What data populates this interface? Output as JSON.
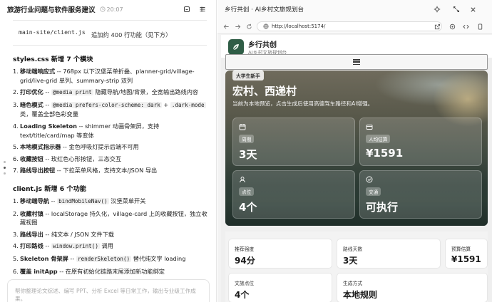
{
  "chat": {
    "title": "旅游行业问题与软件服务建议",
    "time": "20:07",
    "table_row": {
      "file": "main-site/client.js",
      "desc": "追加约 400 行功能（见下方）"
    },
    "styles_heading": "styles.css 新增 7 个模块",
    "styles_items": [
      {
        "num": "1.",
        "label": "移动端响应式",
        "text": " -- 768px 以下汉堡菜单折叠、planner-grid/village-grid/live-grid 单列、summary-strip 双列"
      },
      {
        "num": "2.",
        "label": "打印优化",
        "text": " -- ",
        "code": "@media print",
        "text2": " 隐藏导航/地图/背景，全宽输出路线内容"
      },
      {
        "num": "3.",
        "label": "暗色模式",
        "text": " -- ",
        "code": "@media prefers-color-scheme: dark",
        "text2": " + ",
        "code2": ".dark-mode",
        "text3": " 类，覆盖全部色彩变量"
      },
      {
        "num": "4.",
        "label": "Loading Skeleton",
        "text": " -- shimmer 动画骨架屏，支持 text/title/card/map 等变体"
      },
      {
        "num": "5.",
        "label": "本地模式指示器",
        "text": " -- 金色呼吸灯提示后端不可用"
      },
      {
        "num": "6.",
        "label": "收藏按钮",
        "text": " -- 玫红色心形按钮，三态交互"
      },
      {
        "num": "7.",
        "label": "路线导出按钮",
        "text": " -- 下拉菜单风格，支持文本/JSON 导出"
      }
    ],
    "client_heading": "client.js 新增 6 个功能",
    "client_items": [
      {
        "num": "1.",
        "label": "移动端导航",
        "text": " -- ",
        "code": "bindMobileNav()",
        "text2": " 汉堡菜单开关"
      },
      {
        "num": "2.",
        "label": "收藏村镇",
        "text": " -- localStorage 持久化，village-card 上的收藏按钮，独立收藏视图"
      },
      {
        "num": "3.",
        "label": "路线导出",
        "text": " -- 纯文本 / JSON 文件下载"
      },
      {
        "num": "4.",
        "label": "打印路线",
        "text": " -- ",
        "code": "window.print()",
        "text2": " 调用"
      },
      {
        "num": "5.",
        "label": "Skeleton 骨架屏",
        "text": " -- ",
        "code": "renderSkeleton()",
        "text2": " 替代纯文字 loading"
      },
      {
        "num": "6.",
        "label": "覆盖 initApp",
        "text": " -- 在原有初始化链路末尾添加新功能绑定"
      }
    ],
    "input_placeholder": "帮你整理论文综述、编写 PPT、分析 Excel 等日常工作，输出专业级工作成果。"
  },
  "browser": {
    "title": "乡行共创 · AI乡村文旅规划台",
    "url": "http://localhost:5174/"
  },
  "site": {
    "brand_name": "乡行共创",
    "brand_sub": "AI乡村文旅规划台",
    "hero": {
      "tag": "大学生新手",
      "title": "宏村、西递村",
      "subtitle": "当前为本地预览，点击生成后使用高德驾车路径和AI增强。",
      "cards": [
        {
          "label": "周期",
          "value": "3天",
          "icon": "calendar-icon"
        },
        {
          "label": "人均估算",
          "value": "¥1591",
          "icon": "wallet-icon"
        },
        {
          "label": "点位",
          "value": "4个",
          "icon": "pin-icon"
        },
        {
          "label": "交通",
          "value": "可执行",
          "icon": "check-circle-icon"
        }
      ]
    },
    "stats": [
      {
        "label": "推荐强度",
        "value": "94分"
      },
      {
        "label": "路线天数",
        "value": "3天"
      },
      {
        "label": "预算估算",
        "value": "¥1591"
      },
      {
        "label": "文旅点位",
        "value": "4个"
      },
      {
        "label": "生成方式",
        "value": "本地规则"
      }
    ]
  },
  "colors": {
    "brand_green": "#2f5d46",
    "panel_bg": "#f3f3f3"
  }
}
